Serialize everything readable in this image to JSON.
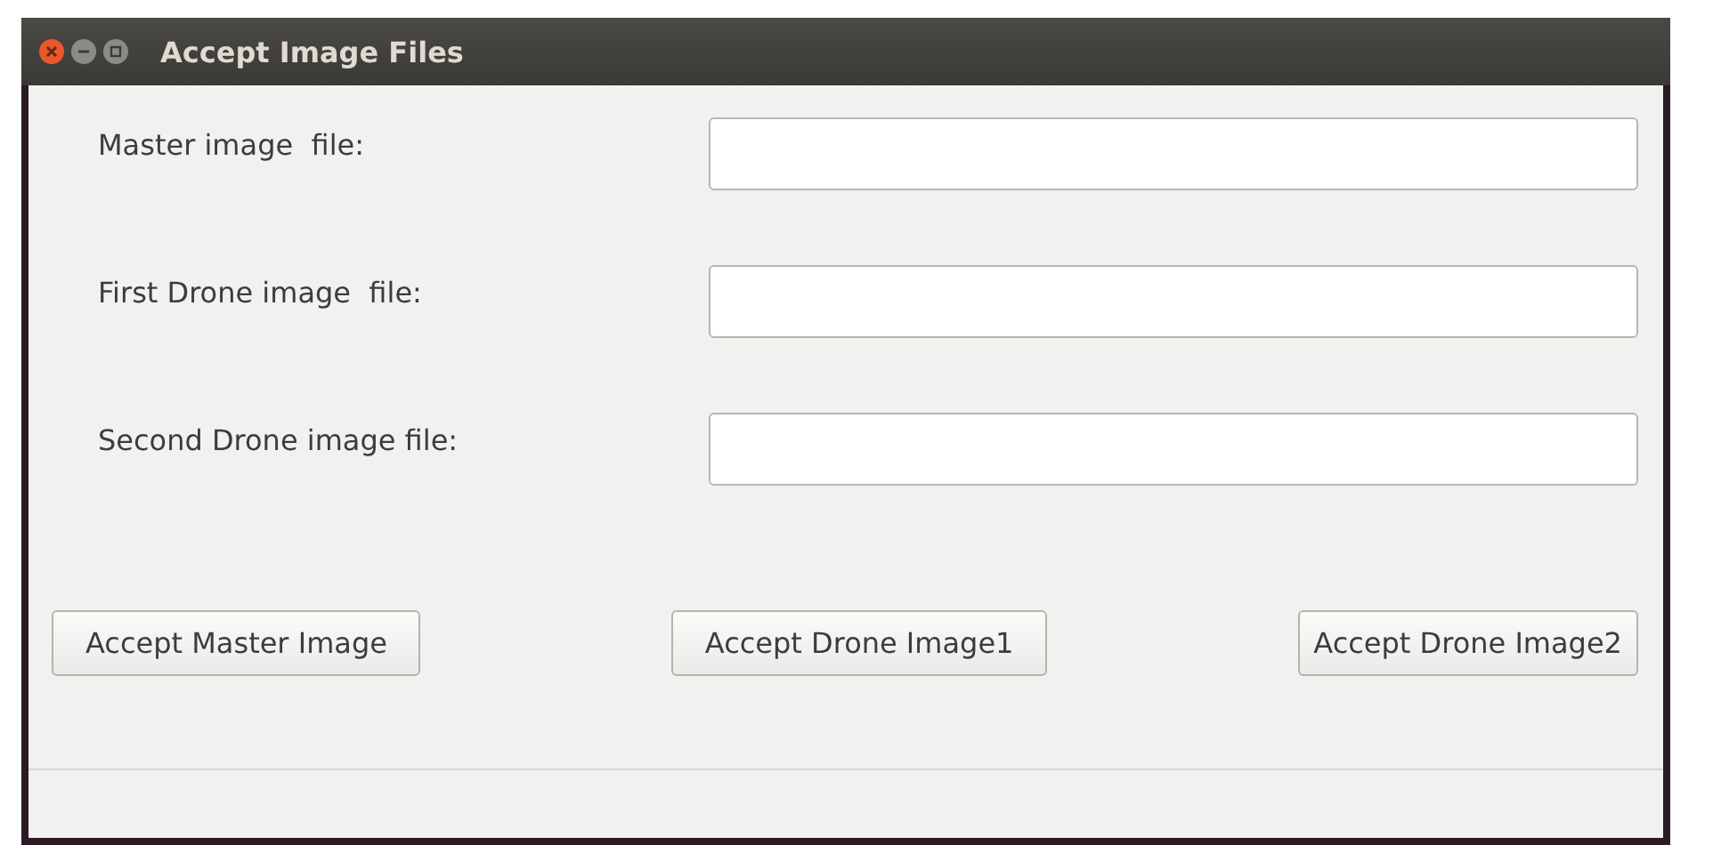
{
  "window": {
    "title": "Accept Image Files"
  },
  "fields": [
    {
      "label": "Master image  file:"
    },
    {
      "label": "First Drone image  file:"
    },
    {
      "label": "Second Drone image file:"
    }
  ],
  "buttons": [
    "Accept Master Image",
    "Accept Drone Image1",
    "Accept Drone Image2"
  ]
}
